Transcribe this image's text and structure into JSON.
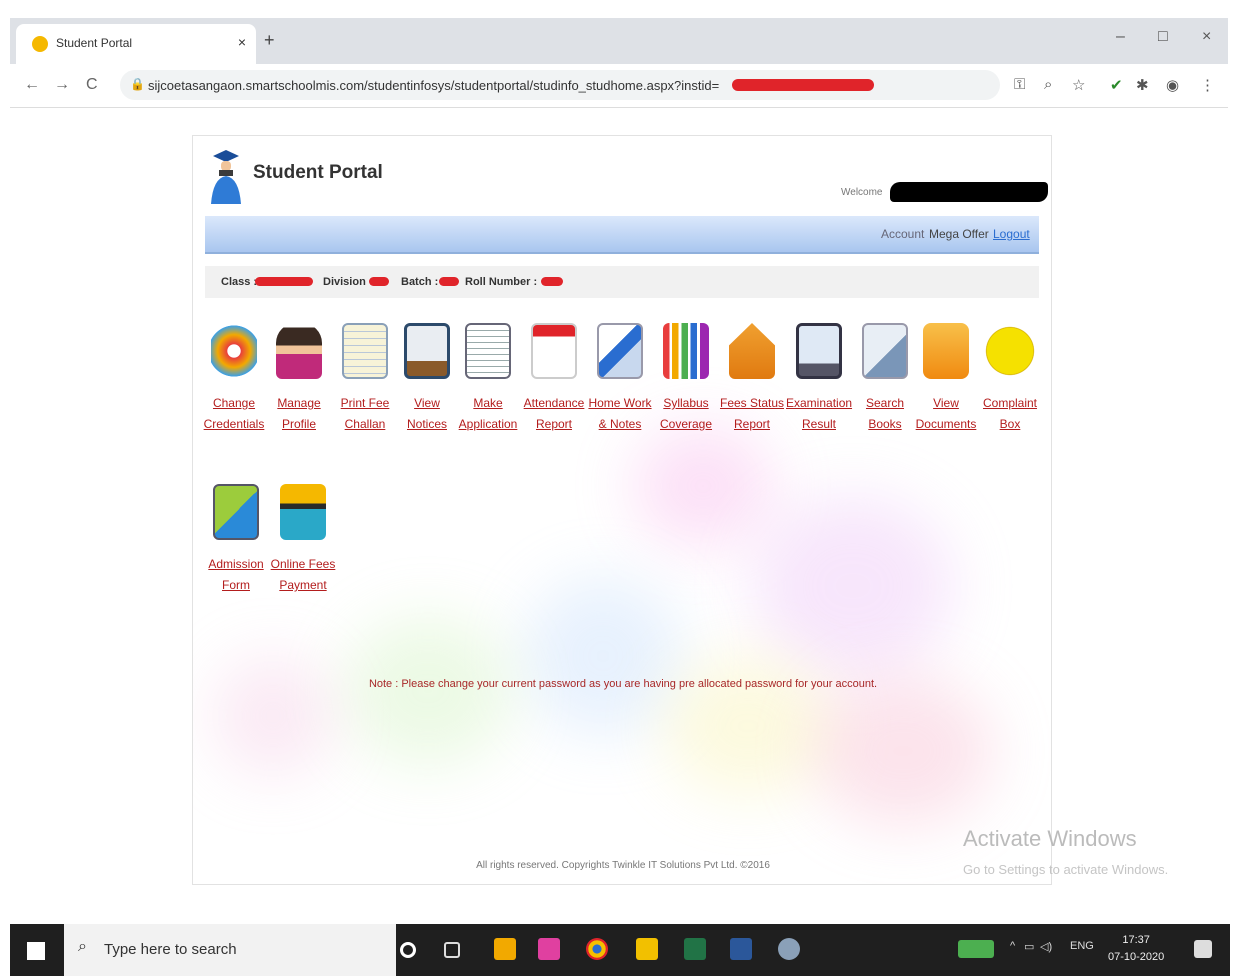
{
  "browser": {
    "tab_title": "Student Portal",
    "tab_close": "×",
    "new_tab": "+",
    "minimize": "–",
    "maximize": "□",
    "close": "×",
    "back": "←",
    "forward": "→",
    "reload": "C",
    "url": "sijcoetasangaon.smartschoolmis.com/studentinfosys/studentportal/studinfo_studhome.aspx?instid="
  },
  "portal": {
    "title": "Student Portal",
    "welcome_label": "Welcome",
    "menu": {
      "account": "Account",
      "mega_offer": "Mega Offer",
      "logout": "Logout"
    },
    "info": {
      "class_label": "Class :",
      "division_label": "Division",
      "batch_label": "Batch :",
      "roll_label": "Roll Number :"
    },
    "tiles_row1": [
      {
        "l1": "Change",
        "l2": "Credentials"
      },
      {
        "l1": "Manage",
        "l2": "Profile"
      },
      {
        "l1": "Print Fee",
        "l2": "Challan"
      },
      {
        "l1": "View",
        "l2": "Notices"
      },
      {
        "l1": "Make",
        "l2": "Application"
      },
      {
        "l1": "Attendance",
        "l2": "Report"
      },
      {
        "l1": "Home Work",
        "l2": "& Notes"
      },
      {
        "l1": "Syllabus",
        "l2": "Coverage"
      },
      {
        "l1": "Fees Status",
        "l2": "Report"
      },
      {
        "l1": "Examination",
        "l2": "Result"
      },
      {
        "l1": "Search",
        "l2": "Books"
      },
      {
        "l1": "View",
        "l2": "Documents"
      },
      {
        "l1": "Complaint",
        "l2": "Box"
      }
    ],
    "tiles_row2": [
      {
        "l1": "Admission",
        "l2": "Form"
      },
      {
        "l1": "Online Fees",
        "l2": "Payment"
      }
    ],
    "note": "Note : Please change your current password as you are having pre allocated password for your account.",
    "footer": "All rights reserved. Copyrights Twinkle IT Solutions Pvt Ltd. ©2016"
  },
  "watermark": {
    "line1": "Activate Windows",
    "line2": "Go to Settings to activate Windows."
  },
  "taskbar": {
    "search_placeholder": "Type here to search",
    "lang": "ENG",
    "time": "17:37",
    "date": "07-10-2020"
  },
  "colors": {
    "link_red": "#b31d1d",
    "menu_blue": "#a9c6ef",
    "taskbar": "#1f1f1f"
  }
}
